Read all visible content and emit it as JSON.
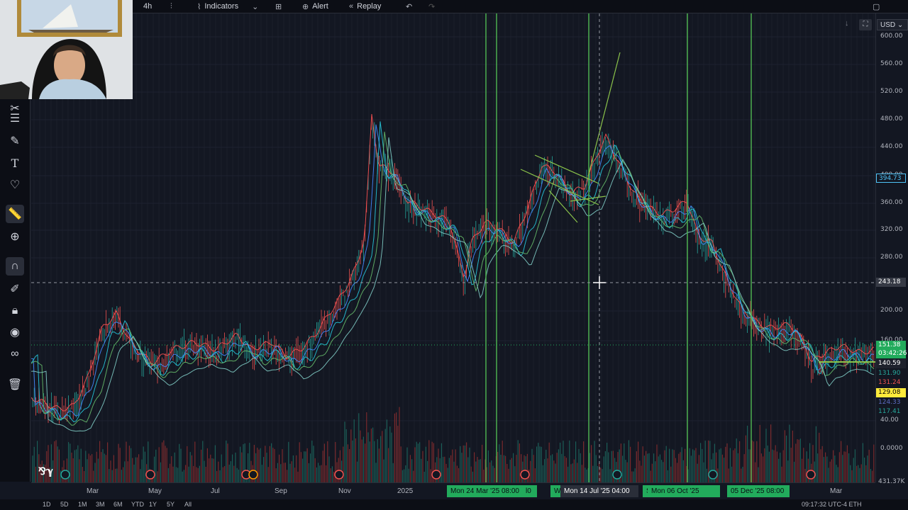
{
  "toolbar": {
    "interval": "4h",
    "indicators_label": "Indicators",
    "alert_label": "Alert",
    "replay_label": "Replay"
  },
  "left_tools": [
    "crosshair-icon",
    "lines-icon",
    "pen-icon",
    "text-icon",
    "heart-icon",
    "ruler-icon",
    "zoom-icon",
    "magnet-icon",
    "lock-pencil-icon",
    "lock-icon",
    "eye-icon",
    "link-icon",
    "trash-icon"
  ],
  "price_axis": {
    "currency": "USD",
    "labels": [
      "600.00",
      "560.00",
      "520.00",
      "480.00",
      "440.00",
      "400.00",
      "360.00",
      "320.00",
      "280.00",
      "200.00",
      "160.00",
      "40.00",
      "0.0000"
    ],
    "crosshair_price": "243.18",
    "tags": [
      {
        "value": "394.73",
        "color": "#4fc3f7",
        "bg": "#131722"
      },
      {
        "value": "151.38",
        "color": "#ffffff",
        "bg": "#22ab5c"
      },
      {
        "value": "03:42:26",
        "color": "#ffffff",
        "bg": "#22ab5c"
      },
      {
        "value": "140.59",
        "color": "#ffffff",
        "bg": "#1e222d"
      },
      {
        "value": "131.90",
        "color": "#26a69a",
        "bg": "#131722"
      },
      {
        "value": "131.24",
        "color": "#ef5350",
        "bg": "#131722"
      },
      {
        "value": "129.08",
        "color": "#000000",
        "bg": "#ffeb3b"
      },
      {
        "value": "124.33",
        "color": "#5c6bc0",
        "bg": "#131722"
      },
      {
        "value": "117.41",
        "color": "#26a69a",
        "bg": "#131722"
      },
      {
        "value": "431.37K",
        "color": "#b2b5be",
        "bg": "#131722"
      }
    ]
  },
  "time_axis": {
    "labels": [
      "Mar",
      "May",
      "Jul",
      "Sep",
      "Nov",
      "2025",
      "Mar"
    ],
    "tags": [
      "Mon 24 Mar '25   08:00",
      "l0",
      "W",
      "Mon 14 Jul '25   04:00",
      "S",
      "Mon 06 Oct '25   08:00",
      "05 Dec '25   08:00"
    ]
  },
  "bottom": {
    "ranges": [
      "1D",
      "5D",
      "1M",
      "3M",
      "6M",
      "YTD",
      "1Y",
      "5Y",
      "All"
    ],
    "clock": "09:17:32 UTC-4   ETH"
  },
  "colors": {
    "background": "#131722",
    "candle_up": "#26a69a",
    "candle_down": "#ef5350",
    "vline": "#4caf50"
  }
}
